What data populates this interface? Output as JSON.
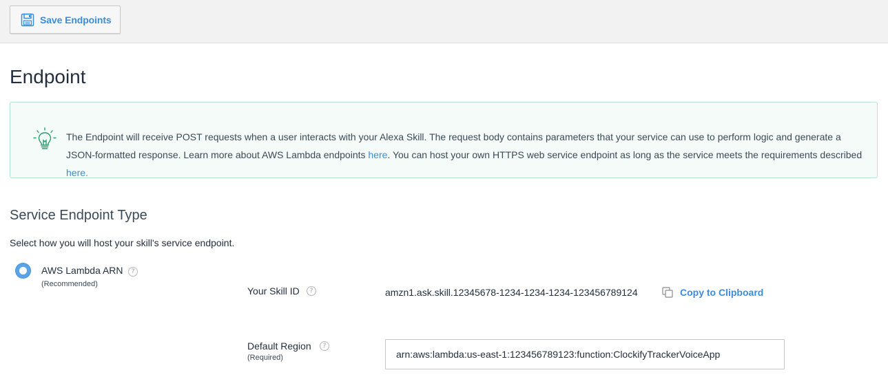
{
  "toolbar": {
    "save_label": "Save Endpoints",
    "save_icon": "floppy-disk-icon"
  },
  "page": {
    "title": "Endpoint"
  },
  "info": {
    "icon": "lightbulb-icon",
    "text_1": "The Endpoint will receive POST requests when a user interacts with your Alexa Skill. The request body contains parameters that your service can use to perform logic and generate a JSON-formatted response. Learn more about AWS Lambda endpoints ",
    "link_1": "here",
    "text_2": ". You can host your own HTTPS web service endpoint as long as the service meets the requirements described ",
    "link_2": "here."
  },
  "service": {
    "title": "Service Endpoint Type",
    "description": "Select how you will host your skill's service endpoint.",
    "option_label": "AWS Lambda ARN",
    "option_sub": "(Recommended)",
    "help_glyph": "?"
  },
  "skill_id": {
    "label": "Your Skill ID",
    "value": "amzn1.ask.skill.12345678-1234-1234-1234-123456789124",
    "copy_label": "Copy to Clipboard"
  },
  "region": {
    "label": "Default Region",
    "sub": "(Required)",
    "value": "arn:aws:lambda:us-east-1:123456789123:function:ClockifyTrackerVoiceApp"
  },
  "colors": {
    "accent": "#3a8dde",
    "info_bg": "#f4fbf9",
    "info_border": "#b7e4cf",
    "toolbar_bg": "#f2f2f2"
  }
}
